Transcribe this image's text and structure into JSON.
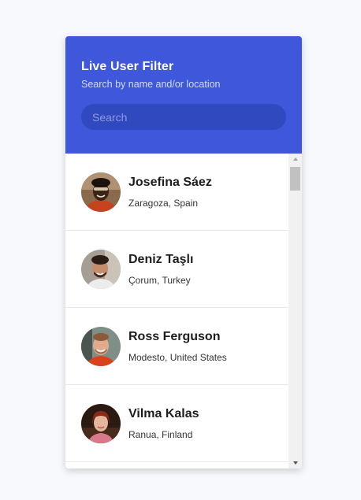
{
  "header": {
    "title": "Live User Filter",
    "subtitle": "Search by name and/or location",
    "search_placeholder": "Search",
    "search_value": ""
  },
  "users": [
    {
      "name": "Josefina Sáez",
      "location": "Zaragoza, Spain",
      "avatar": "josefina-avatar"
    },
    {
      "name": "Deniz Taşlı",
      "location": "Çorum, Turkey",
      "avatar": "deniz-avatar"
    },
    {
      "name": "Ross Ferguson",
      "location": "Modesto, United States",
      "avatar": "ross-avatar"
    },
    {
      "name": "Vilma Kalas",
      "location": "Ranua, Finland",
      "avatar": "vilma-avatar"
    }
  ],
  "colors": {
    "header_bg": "#3e57db",
    "search_bg": "#3149be",
    "page_bg": "#f8f9fd"
  },
  "scroll": {
    "position_fraction": 0.0
  }
}
